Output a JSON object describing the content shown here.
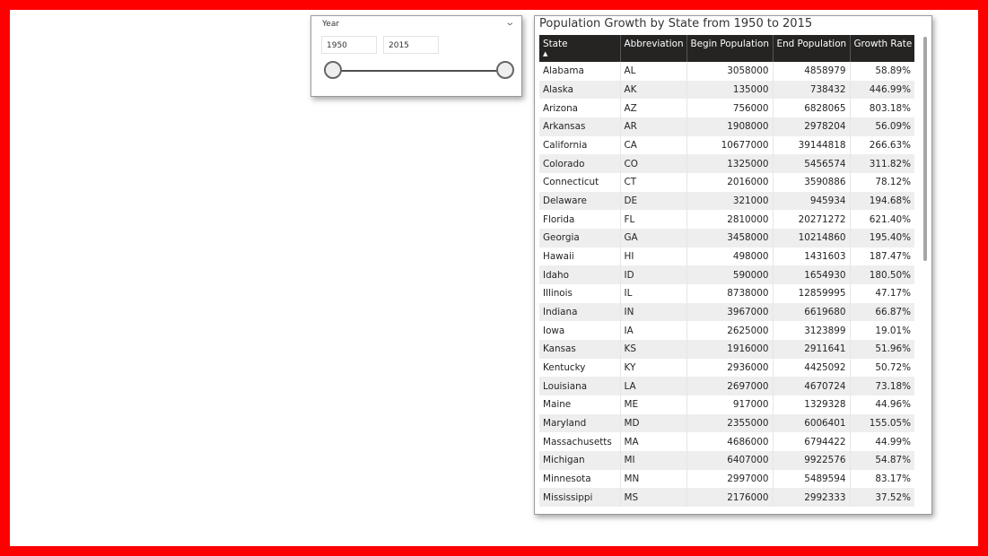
{
  "slicer": {
    "title": "Year",
    "start_value": "1950",
    "end_value": "2015"
  },
  "table": {
    "title": "Population Growth by State from 1950 to 2015",
    "columns": [
      "State",
      "Abbreviation",
      "Begin Population",
      "End Population",
      "Growth Rate"
    ],
    "sort_column": "State",
    "sort_direction": "ascending",
    "rows": [
      [
        "Alabama",
        "AL",
        "3058000",
        "4858979",
        "58.89%"
      ],
      [
        "Alaska",
        "AK",
        "135000",
        "738432",
        "446.99%"
      ],
      [
        "Arizona",
        "AZ",
        "756000",
        "6828065",
        "803.18%"
      ],
      [
        "Arkansas",
        "AR",
        "1908000",
        "2978204",
        "56.09%"
      ],
      [
        "California",
        "CA",
        "10677000",
        "39144818",
        "266.63%"
      ],
      [
        "Colorado",
        "CO",
        "1325000",
        "5456574",
        "311.82%"
      ],
      [
        "Connecticut",
        "CT",
        "2016000",
        "3590886",
        "78.12%"
      ],
      [
        "Delaware",
        "DE",
        "321000",
        "945934",
        "194.68%"
      ],
      [
        "Florida",
        "FL",
        "2810000",
        "20271272",
        "621.40%"
      ],
      [
        "Georgia",
        "GA",
        "3458000",
        "10214860",
        "195.40%"
      ],
      [
        "Hawaii",
        "HI",
        "498000",
        "1431603",
        "187.47%"
      ],
      [
        "Idaho",
        "ID",
        "590000",
        "1654930",
        "180.50%"
      ],
      [
        "Illinois",
        "IL",
        "8738000",
        "12859995",
        "47.17%"
      ],
      [
        "Indiana",
        "IN",
        "3967000",
        "6619680",
        "66.87%"
      ],
      [
        "Iowa",
        "IA",
        "2625000",
        "3123899",
        "19.01%"
      ],
      [
        "Kansas",
        "KS",
        "1916000",
        "2911641",
        "51.96%"
      ],
      [
        "Kentucky",
        "KY",
        "2936000",
        "4425092",
        "50.72%"
      ],
      [
        "Louisiana",
        "LA",
        "2697000",
        "4670724",
        "73.18%"
      ],
      [
        "Maine",
        "ME",
        "917000",
        "1329328",
        "44.96%"
      ],
      [
        "Maryland",
        "MD",
        "2355000",
        "6006401",
        "155.05%"
      ],
      [
        "Massachusetts",
        "MA",
        "4686000",
        "6794422",
        "44.99%"
      ],
      [
        "Michigan",
        "MI",
        "6407000",
        "9922576",
        "54.87%"
      ],
      [
        "Minnesota",
        "MN",
        "2997000",
        "5489594",
        "83.17%"
      ],
      [
        "Mississippi",
        "MS",
        "2176000",
        "2992333",
        "37.52%"
      ]
    ]
  },
  "colors": {
    "frame": "#ff0000",
    "header_bg": "#252423",
    "row_stripe": "#eeeeee"
  }
}
